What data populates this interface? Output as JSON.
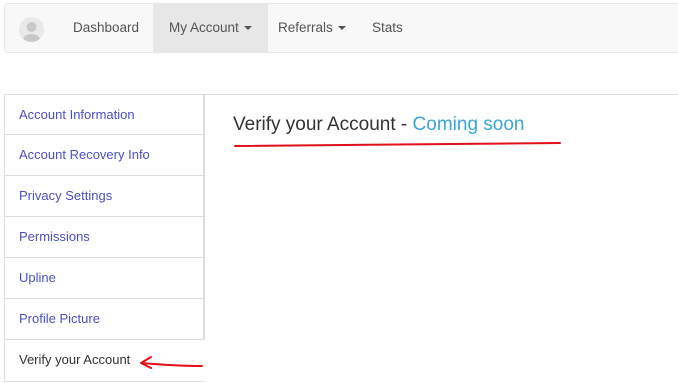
{
  "navbar": {
    "items": [
      {
        "label": "Dashboard"
      },
      {
        "label": "My Account"
      },
      {
        "label": "Referrals"
      },
      {
        "label": "Stats"
      }
    ]
  },
  "sidebar": {
    "items": [
      {
        "label": "Account Information"
      },
      {
        "label": "Account Recovery Info"
      },
      {
        "label": "Privacy Settings"
      },
      {
        "label": "Permissions"
      },
      {
        "label": "Upline"
      },
      {
        "label": "Profile Picture"
      },
      {
        "label": "Verify your Account"
      }
    ]
  },
  "main": {
    "title": "Verify your Account",
    "separator": " - ",
    "status": "Coming soon"
  },
  "colors": {
    "link": "#4a4fc4",
    "accent": "#3aa6d6",
    "annotation": "#e0101c"
  }
}
